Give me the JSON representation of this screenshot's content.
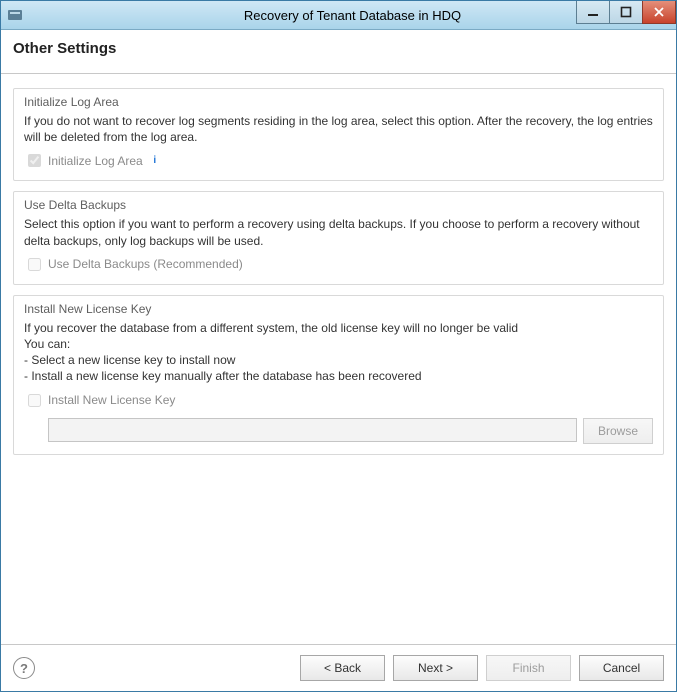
{
  "window": {
    "title": "Recovery of Tenant Database in HDQ"
  },
  "header": {
    "title": "Other Settings"
  },
  "groups": {
    "initLog": {
      "title": "Initialize Log Area",
      "desc": "If you do not want to recover log segments residing in the log area, select this option. After the recovery, the log entries will be deleted from the log area.",
      "checkbox_label": "Initialize Log Area",
      "checked": true
    },
    "delta": {
      "title": "Use Delta Backups",
      "desc": "Select this option if you want to perform a recovery using delta backups. If you choose to perform a recovery without delta backups, only log backups will be used.",
      "checkbox_label": "Use Delta Backups (Recommended)",
      "checked": false
    },
    "license": {
      "title": "Install New License Key",
      "line1": "If you recover the database from a different system, the old license key will no longer be valid",
      "line2": "You can:",
      "line3": "- Select a new license key to install now",
      "line4": "- Install a new license key manually after the database has been recovered",
      "checkbox_label": "Install New License Key",
      "checked": false,
      "path_value": "",
      "browse_label": "Browse"
    }
  },
  "footer": {
    "back": "< Back",
    "next": "Next >",
    "finish": "Finish",
    "cancel": "Cancel"
  }
}
